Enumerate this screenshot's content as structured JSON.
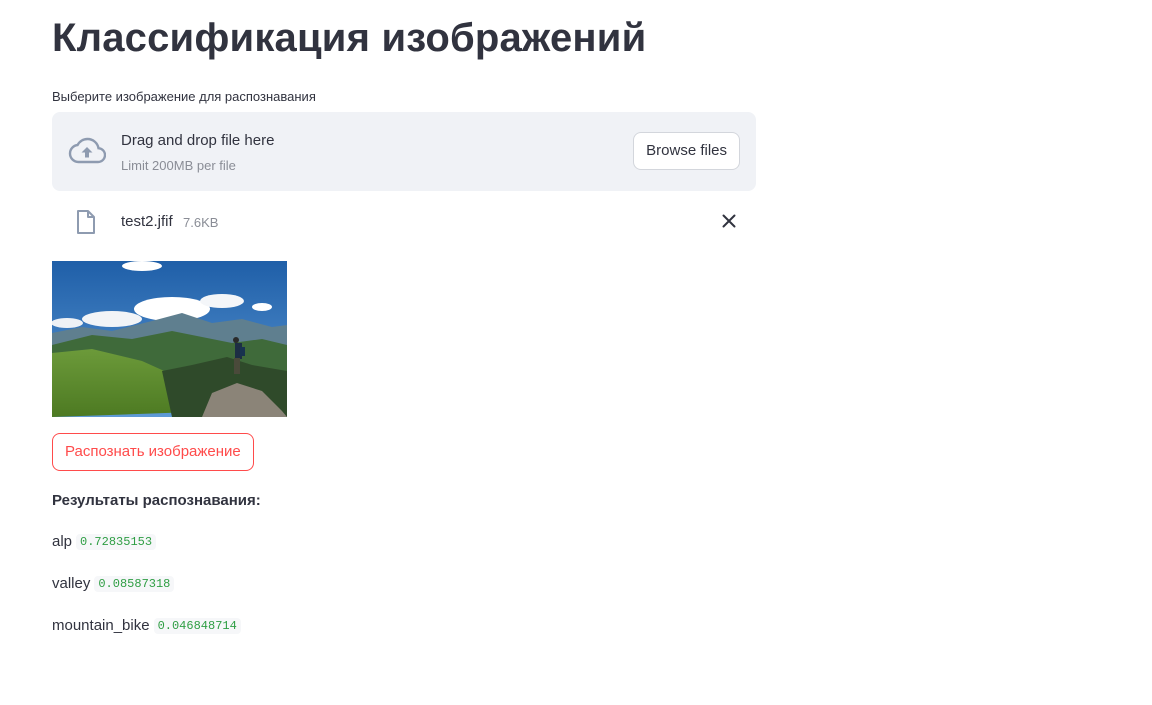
{
  "page": {
    "title": "Классификация изображений"
  },
  "uploader": {
    "label": "Выберите изображение для распознавания",
    "dropzone_title": "Drag and drop file here",
    "dropzone_limit": "Limit 200MB per file",
    "browse_label": "Browse files",
    "icon": "cloud-upload-icon"
  },
  "uploaded_file": {
    "name": "test2.jfif",
    "size": "7.6KB",
    "icon": "file-icon",
    "remove_icon": "close-icon"
  },
  "actions": {
    "predict_label": "Распознать изображение"
  },
  "results": {
    "title": "Результаты распознавания:",
    "items": [
      {
        "label": "alp",
        "score": "0.72835153"
      },
      {
        "label": "valley",
        "score": "0.08587318"
      },
      {
        "label": "mountain_bike",
        "score": "0.046848714"
      }
    ]
  },
  "colors": {
    "accent": "#ff4b4b",
    "text": "#31333f",
    "muted": "#8a8d96",
    "dropzone_bg": "#f0f2f6",
    "score_text": "#2f9e44"
  }
}
